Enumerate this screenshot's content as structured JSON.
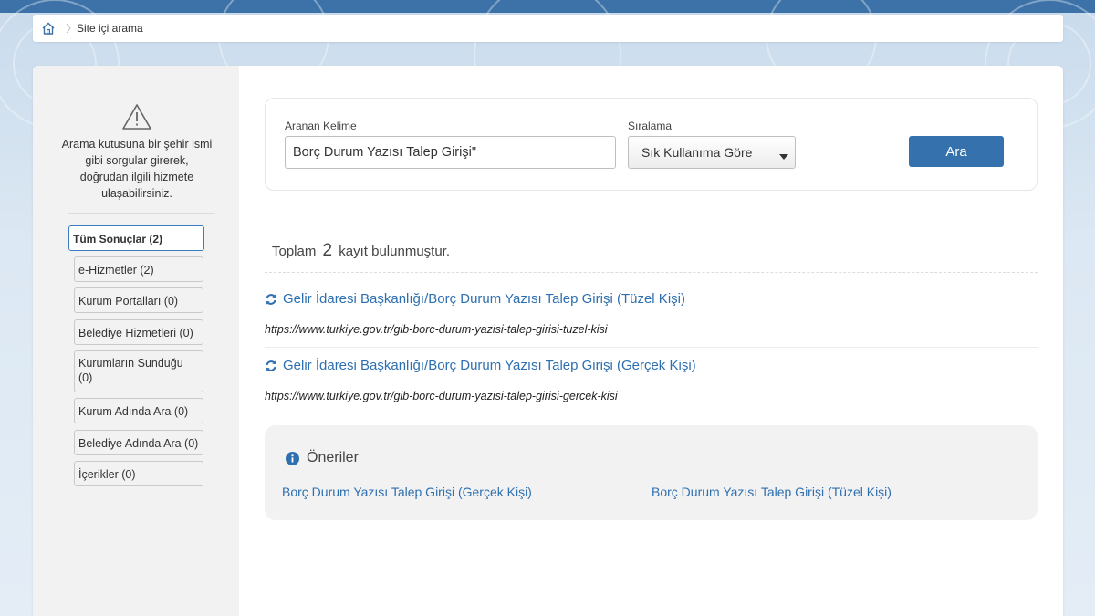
{
  "breadcrumb": {
    "home_icon": "home-icon",
    "current": "Site içi arama"
  },
  "sidebar": {
    "warning_icon": "warning-triangle-icon",
    "note": "Arama kutusuna bir şehir ismi gibi sorgular girerek, doğrudan ilgili hizmete ulaşabilirsiniz.",
    "filters": [
      {
        "label": "Tüm Sonuçlar (2)",
        "active": true
      },
      {
        "label": "e-Hizmetler (2)",
        "active": false
      },
      {
        "label": "Kurum Portalları (0)",
        "active": false
      },
      {
        "label": "Belediye Hizmetleri (0)",
        "active": false
      },
      {
        "label": "Kurumların Sunduğu (0)",
        "active": false
      },
      {
        "label": "Kurum Adında Ara (0)",
        "active": false
      },
      {
        "label": "Belediye Adında Ara (0)",
        "active": false
      },
      {
        "label": "İçerikler (0)",
        "active": false
      }
    ]
  },
  "search": {
    "keyword_label": "Aranan Kelime",
    "keyword_value": "Borç Durum Yazısı Talep Girişi\"",
    "sort_label": "Sıralama",
    "sort_value": "Sık Kullanıma Göre",
    "button_label": "Ara"
  },
  "results": {
    "count_prefix": "Toplam",
    "count": "2",
    "count_suffix": "kayıt bulunmuştur.",
    "items": [
      {
        "title": "Gelir İdaresi Başkanlığı/Borç Durum Yazısı Talep Girişi (Tüzel Kişi)",
        "url": "https://www.turkiye.gov.tr/gib-borc-durum-yazisi-talep-girisi-tuzel-kisi"
      },
      {
        "title": "Gelir İdaresi Başkanlığı/Borç Durum Yazısı Talep Girişi (Gerçek Kişi)",
        "url": "https://www.turkiye.gov.tr/gib-borc-durum-yazisi-talep-girisi-gercek-kisi"
      }
    ]
  },
  "suggestions": {
    "title": "Öneriler",
    "items": [
      "Borç Durum Yazısı Talep Girişi (Gerçek Kişi)",
      "Borç Durum Yazısı Talep Girişi (Tüzel Kişi)"
    ]
  },
  "colors": {
    "brand": "#3d72a8",
    "link": "#2e6fb0",
    "button": "#3571ac"
  }
}
